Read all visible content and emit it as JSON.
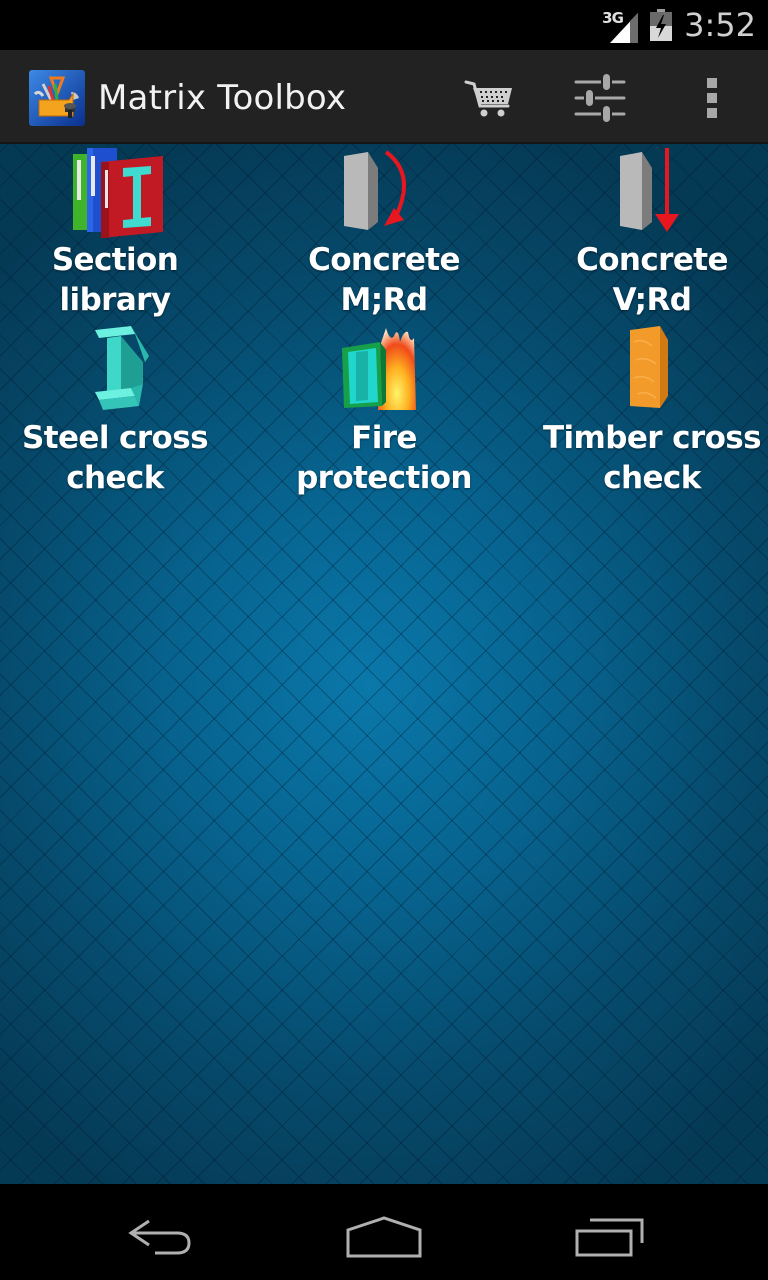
{
  "status_bar": {
    "network_type": "3G",
    "signal_icon": "signal-icon",
    "battery_icon": "battery-charging-icon",
    "time": "3:52"
  },
  "action_bar": {
    "app_icon": "toolbox-icon",
    "title": "Matrix Toolbox",
    "actions": [
      {
        "name": "cart",
        "icon": "shopping-cart-icon"
      },
      {
        "name": "settings",
        "icon": "sliders-icon"
      },
      {
        "name": "overflow",
        "icon": "more-vert-icon"
      }
    ]
  },
  "tools": [
    {
      "label": "Section library",
      "icon": "books-icon"
    },
    {
      "label": "Concrete M;Rd",
      "icon": "concrete-moment-icon"
    },
    {
      "label": "Concrete V;Rd",
      "icon": "concrete-shear-icon"
    },
    {
      "label": "Steel cross check",
      "icon": "steel-ibeam-icon"
    },
    {
      "label": "Fire protection",
      "icon": "fire-protection-icon"
    },
    {
      "label": "Timber cross check",
      "icon": "timber-block-icon"
    }
  ],
  "nav_bar": {
    "back": "back-icon",
    "home": "home-icon",
    "recent": "recent-apps-icon"
  },
  "colors": {
    "action_bar_bg": "#222222",
    "content_bg_center": "#0a78aa",
    "content_bg_edge": "#053a55",
    "arrow_red": "#e8161e"
  }
}
